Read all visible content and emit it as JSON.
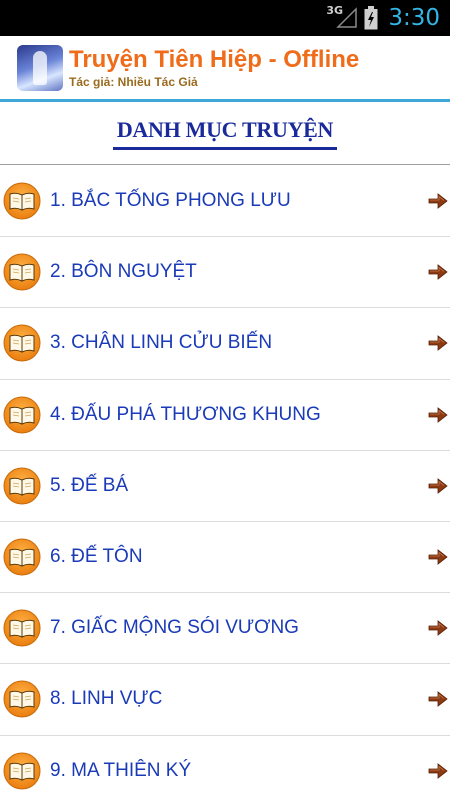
{
  "status_bar": {
    "network": "3G",
    "time": "3:30"
  },
  "header": {
    "title": "Truyện Tiên Hiệp - Offline",
    "subtitle": "Tác giả: Nhiều Tác Giả"
  },
  "section": {
    "title": "DANH MỤC TRUYỆN"
  },
  "stories": [
    {
      "label": "1. BẮC TỐNG PHONG LƯU"
    },
    {
      "label": "2. BÔN NGUYỆT"
    },
    {
      "label": "3. CHÂN LINH CỬU BIẾN"
    },
    {
      "label": "4. ĐẤU PHÁ THƯƠNG KHUNG"
    },
    {
      "label": "5. ĐẾ BÁ"
    },
    {
      "label": "6. ĐẾ TÔN"
    },
    {
      "label": "7. GIẤC MỘNG SÓI VƯƠNG"
    },
    {
      "label": "8. LINH VỰC"
    },
    {
      "label": "9. MA THIÊN KÝ"
    }
  ],
  "icons": {
    "list_item": "book-icon",
    "chevron": "arrow-right-icon",
    "app": "app-icon"
  },
  "colors": {
    "title": "#ef6c1a",
    "subtitle": "#9a6b1e",
    "accent_line": "#3ea9d9",
    "section_title": "#1b2a9a",
    "item_text": "#1a3ab8",
    "clock": "#33b5e5"
  }
}
